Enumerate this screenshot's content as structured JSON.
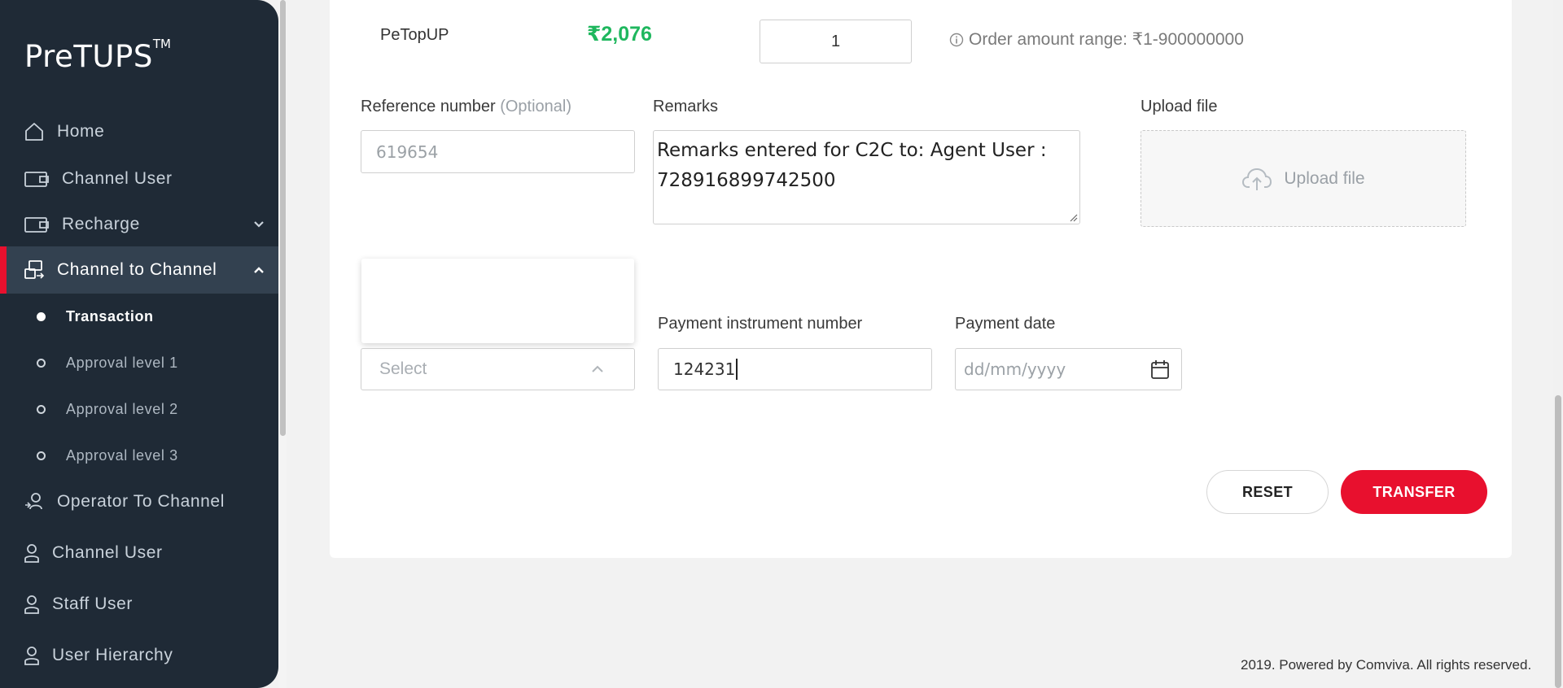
{
  "app": {
    "logo": "PreTUPS",
    "logo_tm": "TM"
  },
  "sidebar": {
    "items": [
      {
        "label": "Home",
        "icon": "home-icon"
      },
      {
        "label": "Channel User",
        "icon": "wallet-icon"
      },
      {
        "label": "Recharge",
        "icon": "wallet-icon"
      },
      {
        "label": "Channel to Channel",
        "icon": "transfer-icon"
      },
      {
        "label": "Operator To Channel",
        "icon": "operator-icon"
      },
      {
        "label": "Channel User",
        "icon": "user-icon"
      },
      {
        "label": "Staff User",
        "icon": "user-icon"
      },
      {
        "label": "User Hierarchy",
        "icon": "user-icon"
      }
    ],
    "sub_items": [
      {
        "label": "Transaction"
      },
      {
        "label": "Approval level 1"
      },
      {
        "label": "Approval level 2"
      },
      {
        "label": "Approval level 3"
      }
    ],
    "active_color": "#e8102e"
  },
  "product": {
    "name": "PeTopUP",
    "amount": "₹2,076",
    "quantity": "1",
    "range_text": "Order amount range: ₹1-900000000"
  },
  "form": {
    "reference_label": "Reference number",
    "reference_optional": "(Optional)",
    "reference_placeholder": "619654",
    "remarks_label": "Remarks",
    "remarks_value": "Remarks entered for C2C to: Agent User : 728916899742500",
    "upload_label": "Upload file",
    "upload_button": "Upload file",
    "payment_type_placeholder": "Select",
    "payment_instrument_label": "Payment instrument number",
    "payment_instrument_value": "124231",
    "payment_date_label": "Payment date",
    "payment_date_placeholder": "dd/mm/yyyy"
  },
  "actions": {
    "reset": "RESET",
    "transfer": "TRANSFER"
  },
  "footer": {
    "text": "2019. Powered by Comviva. All rights reserved."
  }
}
